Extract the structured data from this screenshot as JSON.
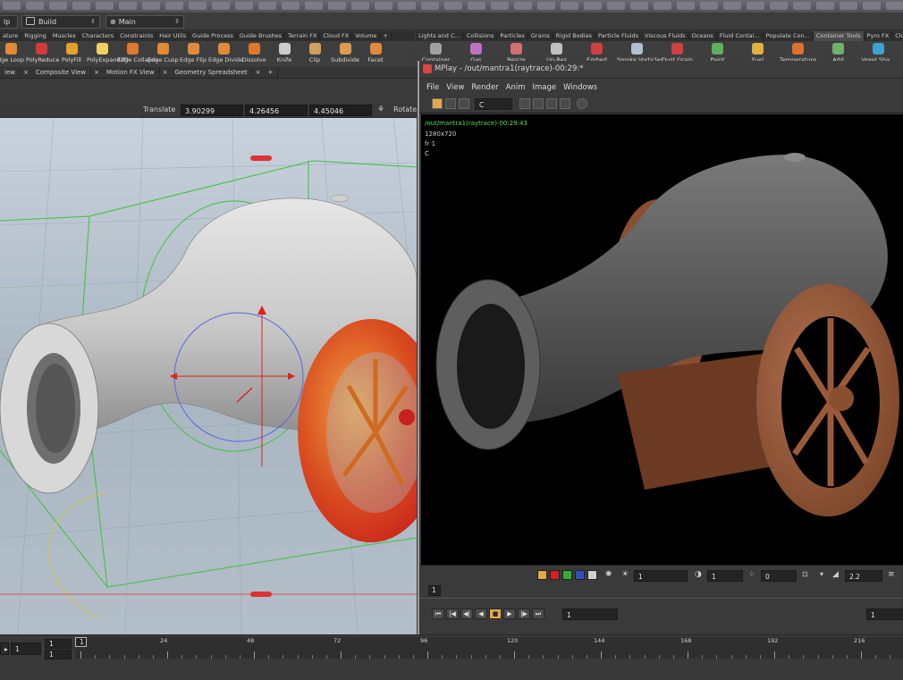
{
  "menubar": {
    "left_label": "lp",
    "desktop": "Build",
    "network": "Main"
  },
  "shelf_tabs_left": [
    "ature",
    "Rigging",
    "Muscles",
    "Characters",
    "Constraints",
    "Hair Utils",
    "Guide Process",
    "Guide Brushes",
    "Terrain FX",
    "Cloud FX",
    "Volume"
  ],
  "shelf_tabs_right": [
    "Lights and C...",
    "Collisions",
    "Particles",
    "Grains",
    "Rigid Bodies",
    "Particle Fluids",
    "Viscous Fluids",
    "Oceans",
    "Fluid Contai...",
    "Populate Con...",
    "Container Tools",
    "Pyro FX",
    "Cloth"
  ],
  "tools_left": [
    {
      "label": "dge Loop",
      "color": "#e08a3a"
    },
    {
      "label": "PolyReduce",
      "color": "#d43a3a"
    },
    {
      "label": "PolyFill",
      "color": "#e6a030"
    },
    {
      "label": "PolyExpand2D",
      "color": "#f0d060"
    },
    {
      "label": "Edge Collapse",
      "color": "#e07830"
    },
    {
      "label": "Edge Cusp",
      "color": "#e08a3a"
    },
    {
      "label": "Edge Flip",
      "color": "#e08a3a"
    },
    {
      "label": "Edge Divide",
      "color": "#e08a3a"
    },
    {
      "label": "Dissolve",
      "color": "#e07830"
    },
    {
      "label": "Knife",
      "color": "#cccccc"
    },
    {
      "label": "Clip",
      "color": "#d0a060"
    },
    {
      "label": "Subdivide",
      "color": "#e09a50"
    },
    {
      "label": "Facet",
      "color": "#e08a3a"
    }
  ],
  "tools_right": [
    {
      "label": "Container",
      "color": "#a0a0a0"
    },
    {
      "label": "Gas",
      "color": "#c070c0"
    },
    {
      "label": "Resize",
      "color": "#d07070"
    },
    {
      "label": "Up-Res",
      "color": "#c0c0c0"
    },
    {
      "label": "Embed",
      "color": "#d04040"
    },
    {
      "label": "Smoke Vorticles",
      "color": "#b0c0d0"
    },
    {
      "label": "Dust Grain",
      "color": "#d04040"
    },
    {
      "label": "Paint",
      "color": "#60b060"
    },
    {
      "label": "Fuel",
      "color": "#e0b040"
    },
    {
      "label": "Temperature",
      "color": "#e07030"
    },
    {
      "label": "Add",
      "color": "#70b070"
    },
    {
      "label": "Voxel Sha...",
      "color": "#40a0d0"
    }
  ],
  "pane_tabs": [
    "iew",
    "Composite View",
    "Motion FX View",
    "Geometry Spreadsheet"
  ],
  "param": {
    "label": "Translate",
    "x": "3.90299",
    "y": "4.26456",
    "z": "4.45046",
    "rotate_label": "Rotate"
  },
  "mplay": {
    "title": "MPlay - /out/mantra1(raytrace)-00:29:*",
    "menus": [
      "File",
      "View",
      "Render",
      "Anim",
      "Image",
      "Windows"
    ],
    "channel": "C",
    "render_path": "/out/mantra1(raytrace)-00:29:43",
    "resolution": "1280x720",
    "frame_label": "fr 1",
    "channel_label": "C",
    "bottom_vals": {
      "v1": "1",
      "v2": "1",
      "v3": "0",
      "gamma": "2.2"
    },
    "frame_field": "1",
    "range_start": "1",
    "range_end": "1"
  },
  "timeline": {
    "frame": "1",
    "start": "1",
    "current": "1",
    "ticks": [
      "24",
      "48",
      "72",
      "96",
      "120",
      "144",
      "168",
      "192",
      "216"
    ]
  },
  "colors": {
    "accent": "#e2a84a",
    "render_bg": "#000000",
    "viewport_bg": "#b5c0cb"
  }
}
